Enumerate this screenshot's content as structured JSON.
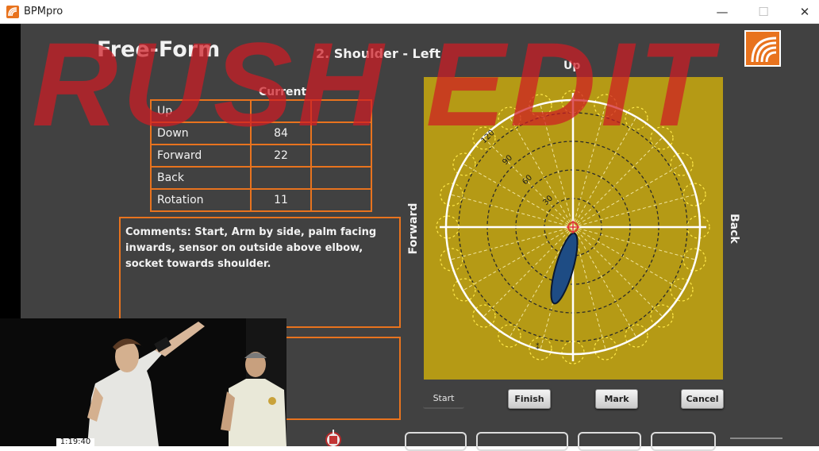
{
  "window": {
    "title": "BPMpro",
    "minimize": "—",
    "maximize": "☐",
    "close": "✕"
  },
  "header": {
    "page_title": "Free-Form",
    "subtitle": "2. Shoulder - Left"
  },
  "watermark": "RUSH EDIT",
  "table": {
    "column_header": "Current",
    "rows": [
      {
        "label": "Up",
        "current": ""
      },
      {
        "label": "Down",
        "current": "84"
      },
      {
        "label": "Forward",
        "current": "22"
      },
      {
        "label": "Back",
        "current": ""
      },
      {
        "label": "Rotation",
        "current": "11"
      }
    ]
  },
  "comments": "Comments: Start, Arm by side, palm facing inwards, sensor on outside above elbow, socket towards shoulder.",
  "polar_chart": {
    "labels": {
      "up": "Up",
      "forward": "Forward",
      "back": "Back"
    },
    "ring_labels": [
      "30",
      "60",
      "90",
      "120"
    ],
    "background_color": "#b59a15",
    "ellipse_color": "#1e4c84",
    "crosshair_color": "#e03030"
  },
  "buttons": {
    "start": "Start",
    "finish": "Finish",
    "mark": "Mark",
    "cancel": "Cancel"
  },
  "video": {
    "timestamp": "1:19:40"
  },
  "colors": {
    "background": "#414141",
    "accent": "#e8731e",
    "text": "#f2f2f2"
  }
}
